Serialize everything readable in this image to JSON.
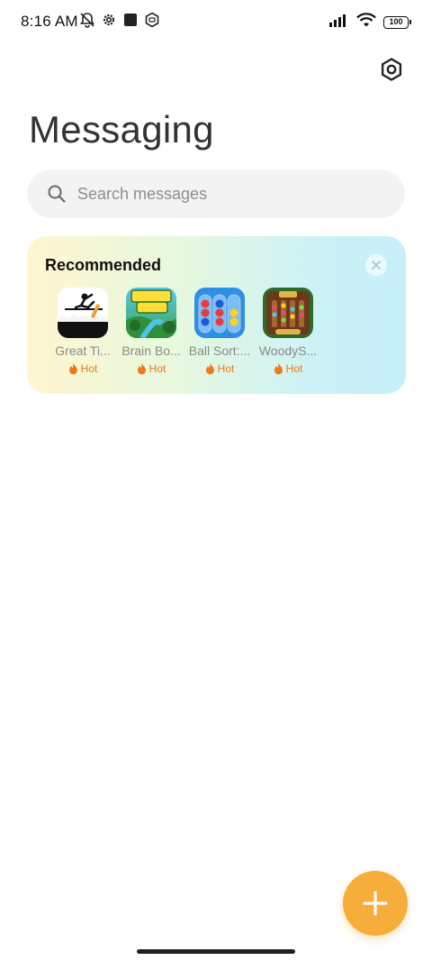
{
  "status_bar": {
    "time": "8:16 AM",
    "battery": "100",
    "icons": [
      "mute-bell-icon",
      "settings-gear-icon",
      "square-icon",
      "hex-app-icon",
      "signal-icon",
      "wifi-icon",
      "battery-icon"
    ]
  },
  "header": {
    "title": "Messaging",
    "settings_icon": "settings-icon"
  },
  "search": {
    "placeholder": "Search messages",
    "value": ""
  },
  "recommended": {
    "title": "Recommended",
    "close_icon": "close-icon",
    "apps": [
      {
        "name": "Great Ti...",
        "badge": "Hot"
      },
      {
        "name": "Brain Bo...",
        "badge": "Hot"
      },
      {
        "name": "Ball Sort:...",
        "badge": "Hot"
      },
      {
        "name": "WoodyS...",
        "badge": "Hot"
      }
    ]
  },
  "fab": {
    "icon": "plus-icon"
  },
  "colors": {
    "accent": "#f6ad3a",
    "hot": "#f07a1a"
  }
}
